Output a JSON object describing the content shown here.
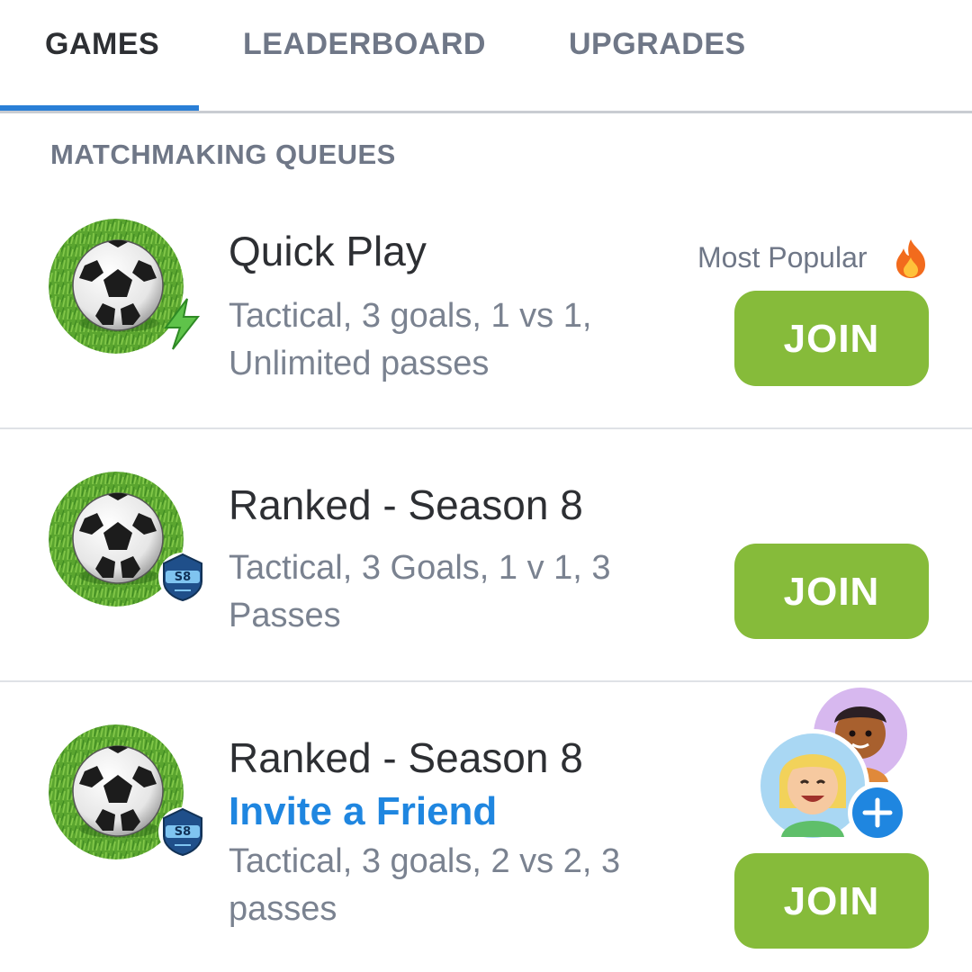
{
  "tabs": [
    {
      "label": "GAMES",
      "active": true
    },
    {
      "label": "LEADERBOARD",
      "active": false
    },
    {
      "label": "UPGRADES",
      "active": false
    }
  ],
  "section": {
    "title": "MATCHMAKING QUEUES"
  },
  "colors": {
    "accent": "#2a7fd6",
    "join": "#86bb3a",
    "link": "#1f86e0",
    "muted": "#7a8290"
  },
  "queues": [
    {
      "title": "Quick Play",
      "description": "Tactical, 3 goals, 1 vs 1, Unlimited passes",
      "tag": "Most Popular",
      "tag_icon": "fire-icon",
      "badge_icon": "lightning-icon",
      "join_label": "JOIN"
    },
    {
      "title": "Ranked - Season 8",
      "description": "Tactical, 3 Goals, 1 v 1, 3 Passes",
      "badge_icon": "season-8-badge-icon",
      "badge_text": "S8",
      "join_label": "JOIN"
    },
    {
      "title": "Ranked - Season 8",
      "link": "Invite a Friend",
      "description": "Tactical, 3 goals, 2 vs 2, 3 passes",
      "badge_icon": "season-8-badge-icon",
      "badge_text": "S8",
      "invite_icons": [
        "friend-avatar-icon",
        "friend-avatar-icon",
        "add-friend-icon"
      ],
      "join_label": "JOIN"
    }
  ]
}
